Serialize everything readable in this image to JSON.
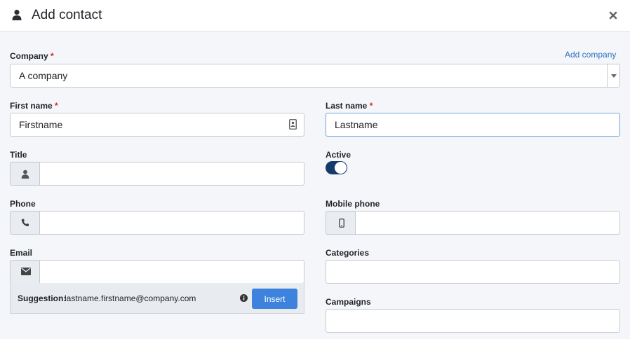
{
  "header": {
    "title": "Add contact",
    "icon": "user-icon",
    "close_icon": "close-icon"
  },
  "company": {
    "label": "Company",
    "required_mark": "*",
    "value": "A company",
    "add_link": "Add company"
  },
  "first_name": {
    "label": "First name",
    "required_mark": "*",
    "value": "Firstname",
    "icon": "contact-card-icon"
  },
  "last_name": {
    "label": "Last name",
    "required_mark": "*",
    "value": "Lastname"
  },
  "title_field": {
    "label": "Title",
    "value": "",
    "icon": "user-icon"
  },
  "active": {
    "label": "Active",
    "on": true
  },
  "phone": {
    "label": "Phone",
    "value": "",
    "icon": "phone-icon"
  },
  "mobile_phone": {
    "label": "Mobile phone",
    "value": "",
    "icon": "mobile-icon"
  },
  "email": {
    "label": "Email",
    "value": "",
    "icon": "envelope-icon"
  },
  "suggestion": {
    "label": "Suggestion:",
    "value": "lastname.firstname@company.com",
    "icon": "info-icon",
    "insert_label": "Insert"
  },
  "categories": {
    "label": "Categories",
    "value": ""
  },
  "campaigns": {
    "label": "Campaigns",
    "value": ""
  },
  "colors": {
    "accent": "#3d82dd",
    "toggle": "#143b6b",
    "required": "#c62828",
    "link": "#2f6fc4"
  }
}
